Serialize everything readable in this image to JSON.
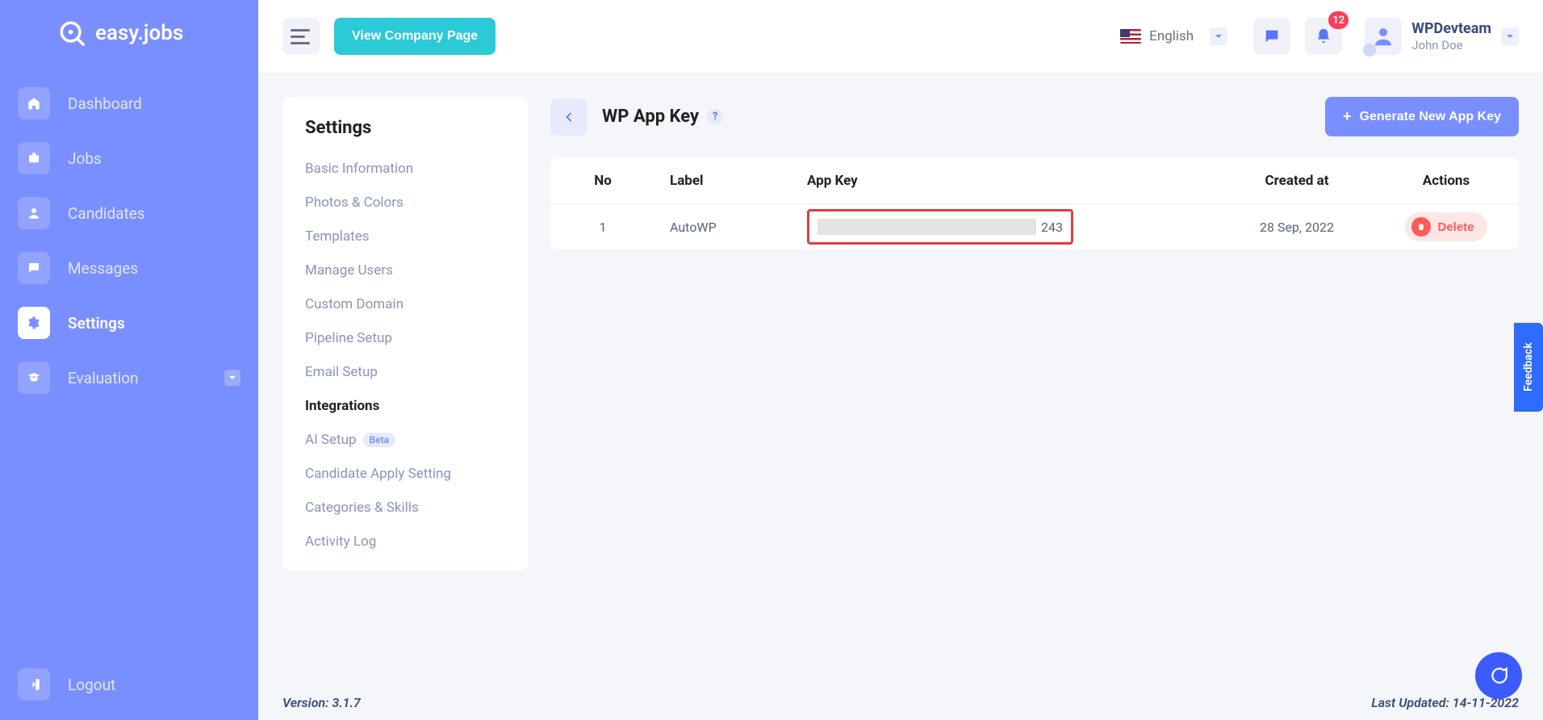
{
  "brand": "easy.jobs",
  "topbar": {
    "view_company": "View Company Page",
    "language": "English",
    "notif_count": "12",
    "company": "WPDevteam",
    "user": "John Doe"
  },
  "sidebar": {
    "items": [
      {
        "label": "Dashboard"
      },
      {
        "label": "Jobs"
      },
      {
        "label": "Candidates"
      },
      {
        "label": "Messages"
      },
      {
        "label": "Settings"
      },
      {
        "label": "Evaluation"
      }
    ],
    "logout": "Logout"
  },
  "settings": {
    "title": "Settings",
    "items": [
      "Basic Information",
      "Photos & Colors",
      "Templates",
      "Manage Users",
      "Custom Domain",
      "Pipeline Setup",
      "Email Setup",
      "Integrations",
      "AI Setup",
      "Candidate Apply Setting",
      "Categories & Skills",
      "Activity Log"
    ],
    "beta_label": "Beta"
  },
  "page": {
    "title": "WP App Key",
    "generate": "Generate New App Key",
    "columns": {
      "no": "No",
      "label": "Label",
      "appkey": "App Key",
      "created": "Created at",
      "actions": "Actions"
    },
    "rows": [
      {
        "no": "1",
        "label": "AutoWP",
        "appkey_tail": "243",
        "created": "28 Sep, 2022",
        "delete": "Delete"
      }
    ]
  },
  "footer": {
    "version_label": "Version: ",
    "version": "3.1.7",
    "updated_label": "Last Updated: ",
    "updated": "14-11-2022"
  },
  "feedback": "Feedback"
}
